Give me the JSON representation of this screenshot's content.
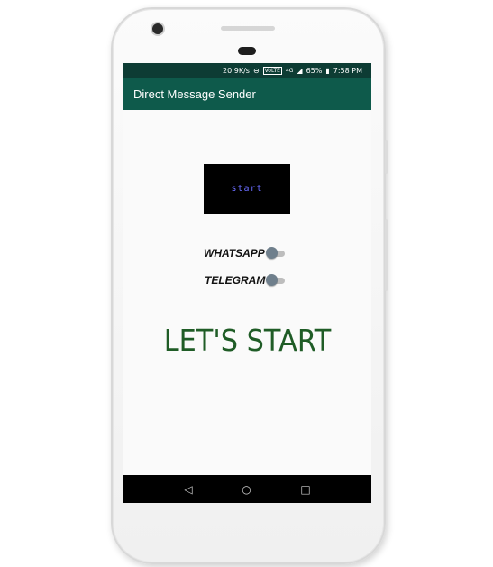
{
  "status_bar": {
    "speed": "20.9K/s",
    "volte": "VoLTE",
    "network": "4G",
    "battery": "65%",
    "time": "7:58 PM"
  },
  "app_bar": {
    "title": "Direct Message Sender"
  },
  "main": {
    "start_button_label": "start",
    "switches": [
      {
        "label": "WHATSAPP",
        "on": false
      },
      {
        "label": "TELEGRAM",
        "on": false
      }
    ],
    "heading": "LET'S START"
  },
  "nav": {
    "back_icon": "◁",
    "home_icon": "○",
    "recents_icon": "□"
  },
  "colors": {
    "status_bar": "#0d3c34",
    "app_bar": "#0e5a4b",
    "heading": "#1f5c26",
    "start_text": "#6a6cff"
  }
}
